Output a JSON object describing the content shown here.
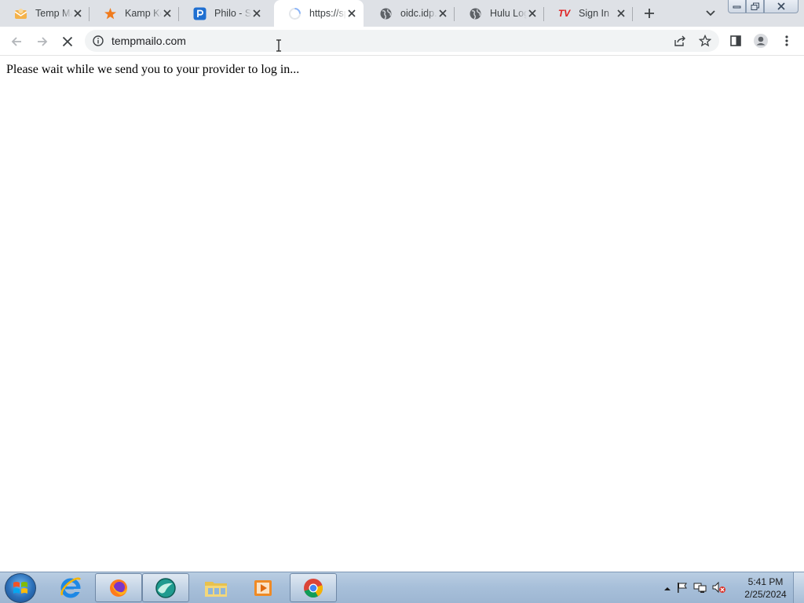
{
  "browser": {
    "tabs": [
      {
        "title": "Temp Ma",
        "favicon": "tempmail-envelope-icon"
      },
      {
        "title": "Kamp Ko",
        "favicon": "orange-star-icon"
      },
      {
        "title": "Philo - St",
        "favicon": "philo-p-icon"
      },
      {
        "title": "https://sp",
        "favicon": "loading-spinner-icon",
        "active": true
      },
      {
        "title": "oidc.idp.",
        "favicon": "globe-icon"
      },
      {
        "title": "Hulu Log",
        "favicon": "globe-icon"
      },
      {
        "title": "Sign In",
        "favicon": "tv-logo-icon",
        "favicon_text": "TV"
      }
    ],
    "address": {
      "url": "tempmailo.com"
    },
    "colors": {
      "tabstrip": "#dee1e6",
      "active_tab": "#ffffff",
      "omnibox": "#f1f3f4"
    }
  },
  "page": {
    "message": "Please wait while we send you to your provider to log in..."
  },
  "taskbar": {
    "pinned": [
      "internet-explorer-icon",
      "firefox-icon",
      "app-icon",
      "file-explorer-icon",
      "media-player-icon",
      "chrome-icon"
    ],
    "clock": {
      "time": "5:41 PM",
      "date": "2/25/2024"
    }
  }
}
